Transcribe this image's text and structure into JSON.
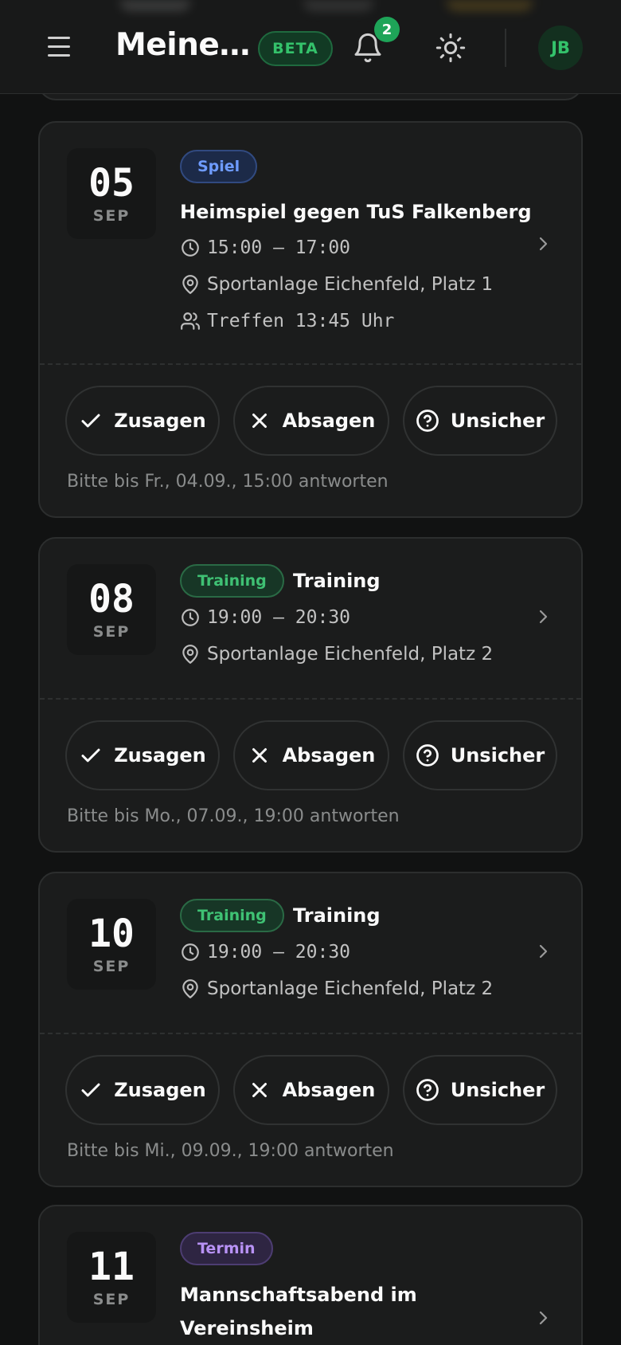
{
  "header": {
    "title": "Meine…",
    "beta_label": "BETA",
    "notification_count": "2",
    "avatar_initials": "JB"
  },
  "events": [
    {
      "day": "05",
      "month": "SEP",
      "tag": "Spiel",
      "title": "Heimspiel gegen TuS Falkenberg",
      "time": "15:00 – 17:00",
      "location": "Sportanlage Eichenfeld, Platz 1",
      "meeting": "Treffen 13:45 Uhr",
      "deadline": "Bitte bis Fr., 04.09., 15:00 antworten"
    },
    {
      "day": "08",
      "month": "SEP",
      "tag": "Training",
      "title": "Training",
      "time": "19:00 – 20:30",
      "location": "Sportanlage Eichenfeld, Platz 2",
      "deadline": "Bitte bis Mo., 07.09., 19:00 antworten"
    },
    {
      "day": "10",
      "month": "SEP",
      "tag": "Training",
      "title": "Training",
      "time": "19:00 – 20:30",
      "location": "Sportanlage Eichenfeld, Platz 2",
      "deadline": "Bitte bis Mi., 09.09., 19:00 antworten"
    },
    {
      "day": "11",
      "month": "SEP",
      "tag": "Termin",
      "title_line1": "Mannschaftsabend im",
      "title_line2": "Vereinsheim"
    }
  ],
  "actions": {
    "accept": "Zusagen",
    "decline": "Absagen",
    "unsure": "Unsicher"
  }
}
